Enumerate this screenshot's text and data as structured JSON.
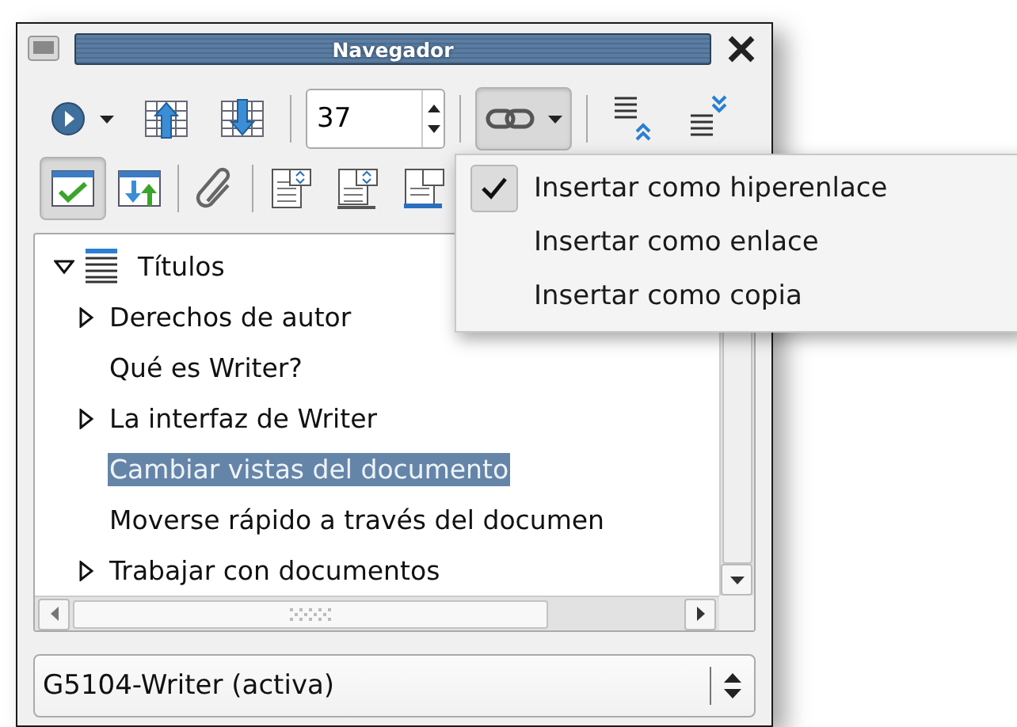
{
  "window": {
    "title": "Navegador"
  },
  "toolbar_rows": [
    [
      {
        "kind": "navigate",
        "pressed": false
      },
      {
        "kind": "previous"
      },
      {
        "kind": "next"
      },
      {
        "kind": "separator"
      },
      {
        "kind": "spin",
        "value": "37"
      },
      {
        "kind": "separator"
      },
      {
        "kind": "drag-mode",
        "pressed": true
      },
      {
        "kind": "separator"
      },
      {
        "kind": "promote"
      },
      {
        "kind": "demote"
      }
    ],
    [
      {
        "kind": "content-view",
        "pressed": true
      },
      {
        "kind": "update"
      },
      {
        "kind": "separator"
      },
      {
        "kind": "attach"
      },
      {
        "kind": "separator"
      },
      {
        "kind": "heading-above"
      },
      {
        "kind": "heading-below"
      },
      {
        "kind": "heading-list"
      }
    ]
  ],
  "tree": [
    {
      "label": "Títulos",
      "expandable": true,
      "expanded": true,
      "selected": false,
      "children": [
        {
          "label": "Derechos de autor",
          "expandable": true,
          "expanded": false,
          "selected": false
        },
        {
          "label": "Qué es Writer?",
          "expandable": false,
          "selected": false
        },
        {
          "label": "La interfaz de Writer",
          "expandable": true,
          "expanded": false,
          "selected": false
        },
        {
          "label": "Cambiar vistas del documento",
          "expandable": false,
          "selected": true
        },
        {
          "label": "Moverse rápido a través del documen",
          "expandable": false,
          "selected": false
        },
        {
          "label": "Trabajar con documentos",
          "expandable": true,
          "expanded": false,
          "selected": false
        }
      ]
    }
  ],
  "document_select": {
    "value": "G5104-Writer (activa)"
  },
  "menu": {
    "items": [
      {
        "label": "Insertar como hiperenlace",
        "checked": true
      },
      {
        "label": "Insertar como enlace",
        "checked": false
      },
      {
        "label": "Insertar como copia",
        "checked": false
      }
    ]
  }
}
